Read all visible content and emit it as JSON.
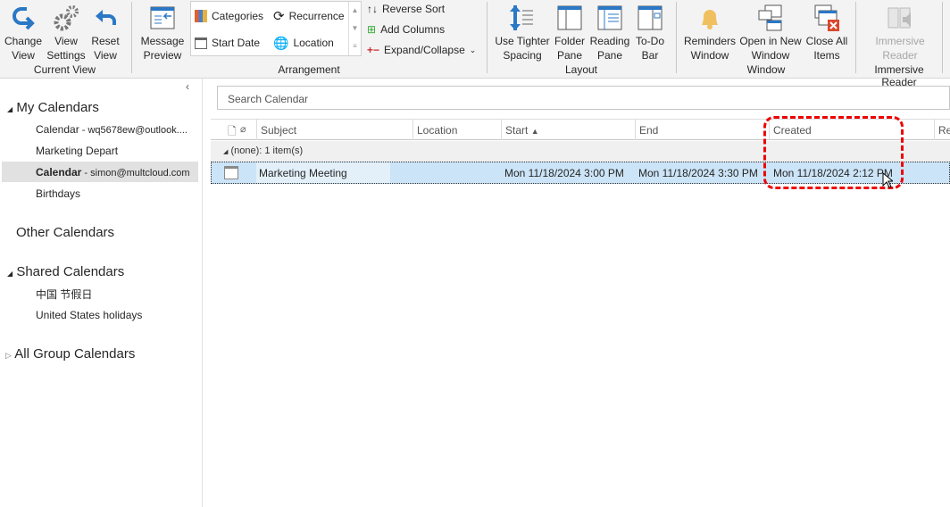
{
  "ribbon": {
    "current_view": {
      "change_view": "Change View",
      "view_settings": "View Settings",
      "reset_view": "Reset View",
      "label": "Current View"
    },
    "arrangement": {
      "message_preview": "Message Preview",
      "categories": "Categories",
      "recurrence": "Recurrence",
      "start_date": "Start Date",
      "location": "Location",
      "reverse_sort": "Reverse Sort",
      "add_columns": "Add Columns",
      "expand_collapse": "Expand/Collapse",
      "label": "Arrangement"
    },
    "layout": {
      "tighter": "Use Tighter Spacing",
      "folder_pane": "Folder Pane",
      "reading_pane": "Reading Pane",
      "todo_bar": "To-Do Bar",
      "label": "Layout"
    },
    "window": {
      "reminders": "Reminders Window",
      "open_new": "Open in New Window",
      "close_all": "Close All Items",
      "label": "Window"
    },
    "immersive": {
      "reader": "Immersive Reader",
      "label": "Immersive Reader"
    }
  },
  "sidebar": {
    "my_calendars": "My Calendars",
    "items": [
      {
        "label": "Calendar",
        "suffix": " - wq5678ew@outlook...."
      },
      {
        "label": "Marketing Depart",
        "suffix": ""
      },
      {
        "label": "Calendar",
        "suffix": " - simon@multcloud.com"
      },
      {
        "label": "Birthdays",
        "suffix": ""
      }
    ],
    "other_calendars": "Other Calendars",
    "shared_calendars": "Shared Calendars",
    "shared_items": [
      "中国 节假日",
      "United States holidays"
    ],
    "all_group": "All Group Calendars"
  },
  "search": {
    "placeholder": "Search Calendar"
  },
  "table": {
    "columns": [
      "Subject",
      "Location",
      "Start",
      "End",
      "Created",
      "Re"
    ],
    "group": "(none): 1 item(s)",
    "rows": [
      {
        "subject": "Marketing Meeting",
        "location": "",
        "start": "Mon 11/18/2024 3:00 PM",
        "end": "Mon 11/18/2024 3:30 PM",
        "created": "Mon 11/18/2024 2:12 PM"
      }
    ]
  },
  "colors": {
    "accent": "#2b78c5",
    "selection": "#cce4f7",
    "highlight": "#e00000"
  }
}
